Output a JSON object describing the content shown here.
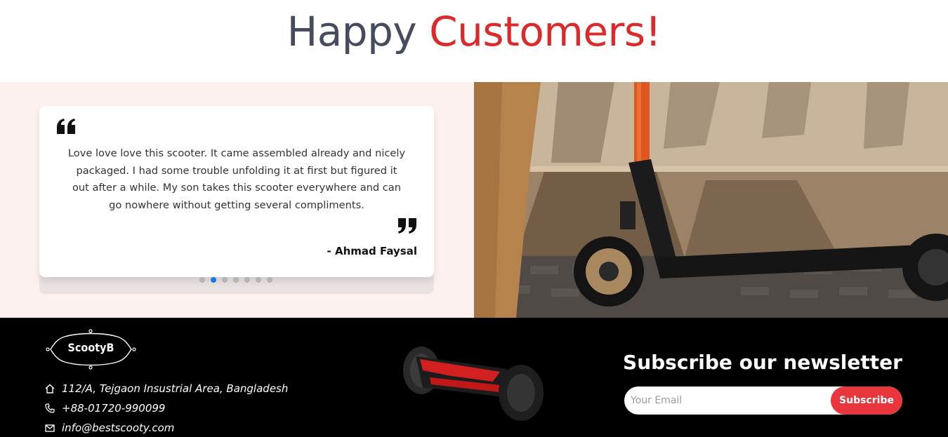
{
  "heading": {
    "part1": "Happy",
    "part2": "Customers!"
  },
  "testimonial": {
    "text": "Love love love this scooter. It came assembled already and nicely packaged. I had some trouble unfolding it at first but figured it out after a while. My son takes this scooter everywhere and can go nowhere without getting several compliments.",
    "author": "- Ahmad Faysal",
    "dots": {
      "total": 7,
      "active": 2
    }
  },
  "footer": {
    "logo_text": "ScootyB",
    "address": "112/A, Tejgaon Insustrial Area, Bangladesh",
    "phone": "+88-01720-990099",
    "email": "info@bestscooty.com",
    "newsletter_title": "Subscribe our newsletter",
    "email_placeholder": "Your Email",
    "subscribe_label": "Subscribe"
  },
  "colors": {
    "accent": "#dc2a2a",
    "button": "#e8363c",
    "dot_active": "#1279e8",
    "testimonial_bg": "#fdf1f0"
  },
  "icons": [
    "quote-open-icon",
    "quote-close-icon",
    "home-icon",
    "phone-icon",
    "mail-icon"
  ]
}
